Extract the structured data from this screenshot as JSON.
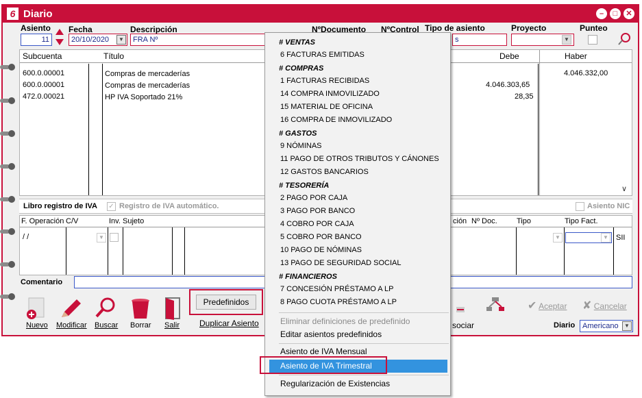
{
  "window": {
    "title": "Diario",
    "logo": "6"
  },
  "header": {
    "asiento_label": "Asiento",
    "asiento_value": "11",
    "fecha_label": "Fecha",
    "fecha_value": "20/10/2020",
    "descripcion_label": "Descripción",
    "descripcion_value": "FRA Nº",
    "ndocumento_label": "NºDocumento",
    "ncontrol_label": "NºControl",
    "tipo_asiento_label": "Tipo de asiento",
    "tipo_asiento_value": "s",
    "proyecto_label": "Proyecto",
    "punteo_label": "Punteo"
  },
  "grid": {
    "columns": [
      "Subcuenta",
      "Título",
      "Debe",
      "Haber"
    ],
    "rows": [
      {
        "subcuenta": "600.0.00001",
        "titulo": "Compras de mercaderías",
        "debe": "",
        "haber": "4.046.332,00"
      },
      {
        "subcuenta": "600.0.00001",
        "titulo": "Compras de mercaderías",
        "debe": "4.046.303,65",
        "haber": ""
      },
      {
        "subcuenta": "472.0.00021",
        "titulo": "HP IVA Soportado 21%",
        "debe": "28,35",
        "haber": ""
      }
    ]
  },
  "iva": {
    "title": "Libro registro de IVA",
    "auto_label": "Registro de IVA automático.",
    "nic_label": "Asiento NIC",
    "columns": [
      "F. Operación",
      "C/V",
      "Inv.",
      "Sujeto",
      "ción",
      "Nº Doc.",
      "Tipo",
      "Tipo Fact."
    ],
    "row": {
      "fecha": "/  /",
      "extra": "SII"
    }
  },
  "comment": {
    "label": "Comentario"
  },
  "toolbar": {
    "nuevo": "Nuevo",
    "modificar": "Modificar",
    "buscar": "Buscar",
    "borrar": "Borrar",
    "salir": "Salir",
    "predefinidos": "Predefinidos",
    "duplicar": "Duplicar Asiento",
    "asociar": "sociar",
    "aceptar": "Aceptar",
    "cancelar": "Cancelar",
    "diario_label": "Diario",
    "diario_value": "Americano"
  },
  "menu": {
    "groups": [
      {
        "header": "# VENTAS",
        "items": [
          "6 FACTURAS EMITIDAS"
        ]
      },
      {
        "header": "# COMPRAS",
        "items": [
          "1 FACTURAS RECIBIDAS",
          "14 COMPRA INMOVILIZADO",
          "15 MATERIAL DE OFICINA",
          "16 COMPRA DE INMOVILIZADO"
        ]
      },
      {
        "header": "# GASTOS",
        "items": [
          "9 NÓMINAS",
          "11 PAGO DE OTROS TRIBUTOS Y CÁNONES",
          "12 GASTOS BANCARIOS"
        ]
      },
      {
        "header": "# TESORERÍA",
        "items": [
          "2 PAGO POR CAJA",
          "3 PAGO POR BANCO",
          "4 COBRO POR CAJA",
          "5 COBRO POR BANCO",
          "10 PAGO DE NÓMINAS",
          "13 PAGO DE SEGURIDAD SOCIAL"
        ]
      },
      {
        "header": "# FINANCIEROS",
        "items": [
          "7 CONCESIÓN PRÉSTAMO A LP",
          "8 PAGO CUOTA PRÉSTAMO A LP"
        ]
      }
    ],
    "eliminar": "Eliminar definiciones de predefinido",
    "editar": "Editar asientos predefinidos",
    "mensual": "Asiento de IVA Mensual",
    "trimestral": "Asiento de IVA Trimestral",
    "regularizacion": "Regularización de Existencias"
  },
  "colors": {
    "accent": "#c8103a",
    "highlight": "#3393df",
    "blue_text": "#1c2a8c"
  }
}
